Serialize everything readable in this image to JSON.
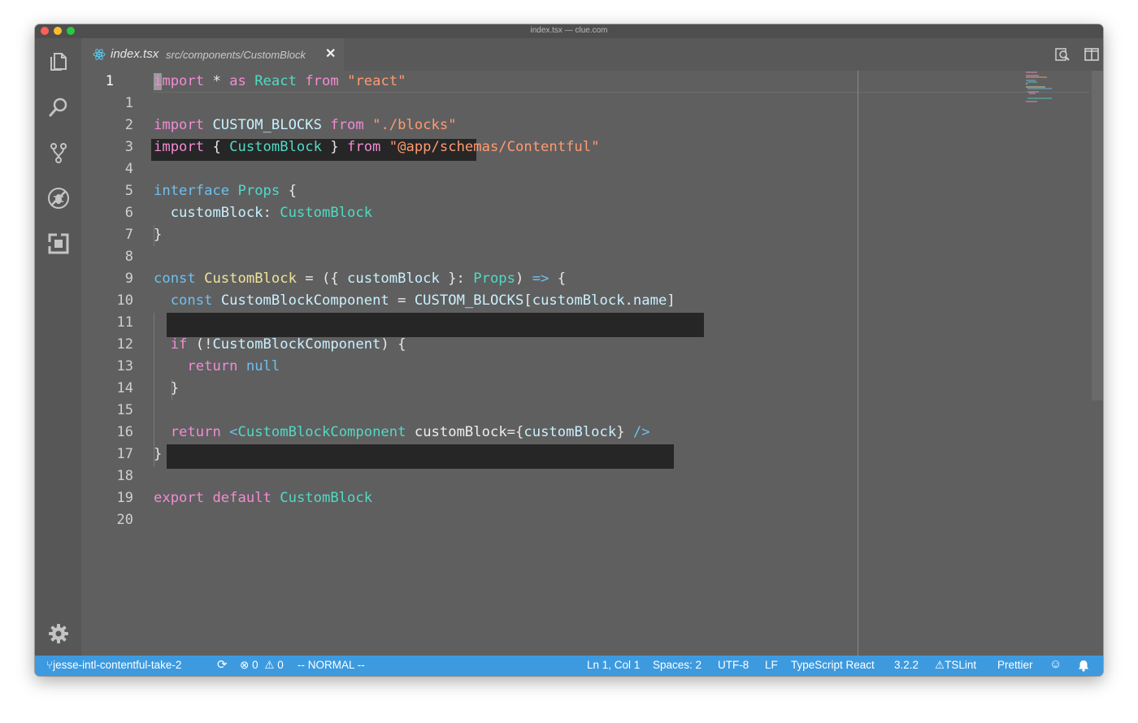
{
  "window": {
    "title": "index.tsx — clue.com"
  },
  "tab": {
    "name": "index.tsx",
    "path": "src/components/CustomBlock",
    "close": "✕"
  },
  "activity_icons": [
    "files-icon",
    "search-icon",
    "source-control-icon",
    "debug-icon",
    "extensions-icon",
    "gear-icon"
  ],
  "editor": {
    "line_numbers": [
      "1",
      "1",
      "2",
      "3",
      "4",
      "5",
      "6",
      "7",
      "8",
      "9",
      "10",
      "11",
      "12",
      "13",
      "14",
      "15",
      "16",
      "17",
      "18",
      "19",
      "20"
    ],
    "code_lines": [
      "import * as React from \"react\"",
      "",
      "import CUSTOM_BLOCKS from \"./blocks\"",
      "import { CustomBlock } from \"@app/schemas/Contentful\"",
      "",
      "interface Props {",
      "  customBlock: CustomBlock",
      "}",
      "",
      "const CustomBlock = ({ customBlock }: Props) => {",
      "  const CustomBlockComponent = CUSTOM_BLOCKS[customBlock.name]",
      "",
      "  if (!CustomBlockComponent) {",
      "    return null",
      "  }",
      "",
      "  return <CustomBlockComponent customBlock={customBlock} />",
      "}",
      "",
      "export default CustomBlock",
      ""
    ]
  },
  "statusbar": {
    "branch": "jesse-intl-contentful-take-2",
    "errors": "0",
    "warnings": "0",
    "mode": "-- NORMAL --",
    "position": "Ln 1, Col 1",
    "spaces": "Spaces: 2",
    "encoding": "UTF-8",
    "eol": "LF",
    "language": "TypeScript React",
    "ts_version": "3.2.2",
    "lint": "TSLint",
    "formatter": "Prettier"
  },
  "colors": {
    "statusbar": "#3d9adf",
    "editor_bg": "#5f5f5f",
    "keyword": "#f08cd3",
    "string": "#ff9a72",
    "type": "#52d9c4"
  }
}
